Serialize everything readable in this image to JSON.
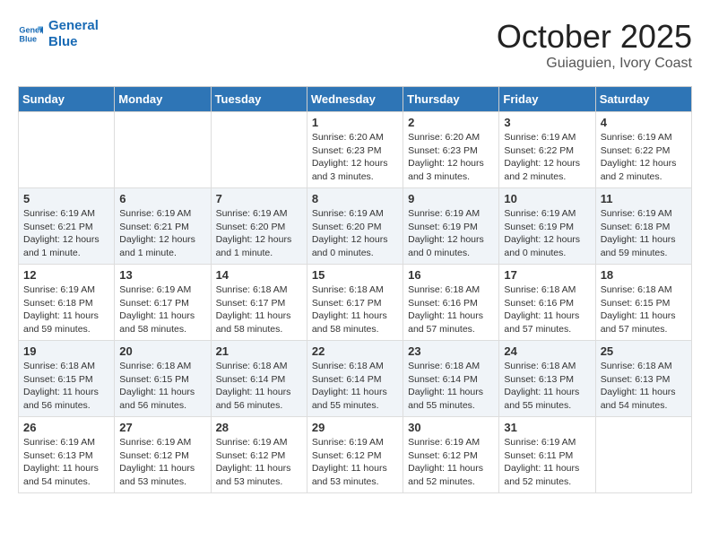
{
  "logo": {
    "line1": "General",
    "line2": "Blue"
  },
  "title": "October 2025",
  "subtitle": "Guiaguien, Ivory Coast",
  "days_of_week": [
    "Sunday",
    "Monday",
    "Tuesday",
    "Wednesday",
    "Thursday",
    "Friday",
    "Saturday"
  ],
  "weeks": [
    [
      {
        "day": "",
        "content": ""
      },
      {
        "day": "",
        "content": ""
      },
      {
        "day": "",
        "content": ""
      },
      {
        "day": "1",
        "content": "Sunrise: 6:20 AM\nSunset: 6:23 PM\nDaylight: 12 hours\nand 3 minutes."
      },
      {
        "day": "2",
        "content": "Sunrise: 6:20 AM\nSunset: 6:23 PM\nDaylight: 12 hours\nand 3 minutes."
      },
      {
        "day": "3",
        "content": "Sunrise: 6:19 AM\nSunset: 6:22 PM\nDaylight: 12 hours\nand 2 minutes."
      },
      {
        "day": "4",
        "content": "Sunrise: 6:19 AM\nSunset: 6:22 PM\nDaylight: 12 hours\nand 2 minutes."
      }
    ],
    [
      {
        "day": "5",
        "content": "Sunrise: 6:19 AM\nSunset: 6:21 PM\nDaylight: 12 hours\nand 1 minute."
      },
      {
        "day": "6",
        "content": "Sunrise: 6:19 AM\nSunset: 6:21 PM\nDaylight: 12 hours\nand 1 minute."
      },
      {
        "day": "7",
        "content": "Sunrise: 6:19 AM\nSunset: 6:20 PM\nDaylight: 12 hours\nand 1 minute."
      },
      {
        "day": "8",
        "content": "Sunrise: 6:19 AM\nSunset: 6:20 PM\nDaylight: 12 hours\nand 0 minutes."
      },
      {
        "day": "9",
        "content": "Sunrise: 6:19 AM\nSunset: 6:19 PM\nDaylight: 12 hours\nand 0 minutes."
      },
      {
        "day": "10",
        "content": "Sunrise: 6:19 AM\nSunset: 6:19 PM\nDaylight: 12 hours\nand 0 minutes."
      },
      {
        "day": "11",
        "content": "Sunrise: 6:19 AM\nSunset: 6:18 PM\nDaylight: 11 hours\nand 59 minutes."
      }
    ],
    [
      {
        "day": "12",
        "content": "Sunrise: 6:19 AM\nSunset: 6:18 PM\nDaylight: 11 hours\nand 59 minutes."
      },
      {
        "day": "13",
        "content": "Sunrise: 6:19 AM\nSunset: 6:17 PM\nDaylight: 11 hours\nand 58 minutes."
      },
      {
        "day": "14",
        "content": "Sunrise: 6:18 AM\nSunset: 6:17 PM\nDaylight: 11 hours\nand 58 minutes."
      },
      {
        "day": "15",
        "content": "Sunrise: 6:18 AM\nSunset: 6:17 PM\nDaylight: 11 hours\nand 58 minutes."
      },
      {
        "day": "16",
        "content": "Sunrise: 6:18 AM\nSunset: 6:16 PM\nDaylight: 11 hours\nand 57 minutes."
      },
      {
        "day": "17",
        "content": "Sunrise: 6:18 AM\nSunset: 6:16 PM\nDaylight: 11 hours\nand 57 minutes."
      },
      {
        "day": "18",
        "content": "Sunrise: 6:18 AM\nSunset: 6:15 PM\nDaylight: 11 hours\nand 57 minutes."
      }
    ],
    [
      {
        "day": "19",
        "content": "Sunrise: 6:18 AM\nSunset: 6:15 PM\nDaylight: 11 hours\nand 56 minutes."
      },
      {
        "day": "20",
        "content": "Sunrise: 6:18 AM\nSunset: 6:15 PM\nDaylight: 11 hours\nand 56 minutes."
      },
      {
        "day": "21",
        "content": "Sunrise: 6:18 AM\nSunset: 6:14 PM\nDaylight: 11 hours\nand 56 minutes."
      },
      {
        "day": "22",
        "content": "Sunrise: 6:18 AM\nSunset: 6:14 PM\nDaylight: 11 hours\nand 55 minutes."
      },
      {
        "day": "23",
        "content": "Sunrise: 6:18 AM\nSunset: 6:14 PM\nDaylight: 11 hours\nand 55 minutes."
      },
      {
        "day": "24",
        "content": "Sunrise: 6:18 AM\nSunset: 6:13 PM\nDaylight: 11 hours\nand 55 minutes."
      },
      {
        "day": "25",
        "content": "Sunrise: 6:18 AM\nSunset: 6:13 PM\nDaylight: 11 hours\nand 54 minutes."
      }
    ],
    [
      {
        "day": "26",
        "content": "Sunrise: 6:19 AM\nSunset: 6:13 PM\nDaylight: 11 hours\nand 54 minutes."
      },
      {
        "day": "27",
        "content": "Sunrise: 6:19 AM\nSunset: 6:12 PM\nDaylight: 11 hours\nand 53 minutes."
      },
      {
        "day": "28",
        "content": "Sunrise: 6:19 AM\nSunset: 6:12 PM\nDaylight: 11 hours\nand 53 minutes."
      },
      {
        "day": "29",
        "content": "Sunrise: 6:19 AM\nSunset: 6:12 PM\nDaylight: 11 hours\nand 53 minutes."
      },
      {
        "day": "30",
        "content": "Sunrise: 6:19 AM\nSunset: 6:12 PM\nDaylight: 11 hours\nand 52 minutes."
      },
      {
        "day": "31",
        "content": "Sunrise: 6:19 AM\nSunset: 6:11 PM\nDaylight: 11 hours\nand 52 minutes."
      },
      {
        "day": "",
        "content": ""
      }
    ]
  ]
}
